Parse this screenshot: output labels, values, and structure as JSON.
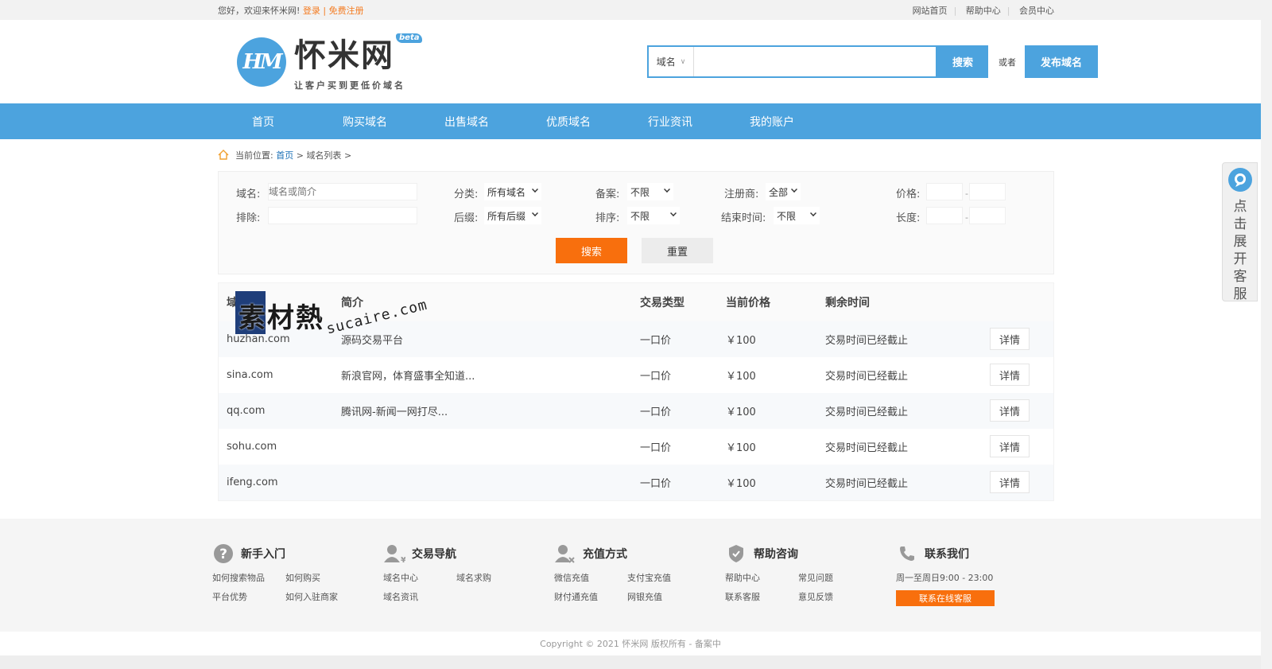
{
  "topbar": {
    "greeting": "您好，欢迎来怀米网!",
    "login": "登录",
    "divider": "|",
    "register": "免费注册",
    "links": [
      "网站首页",
      "帮助中心",
      "会员中心"
    ]
  },
  "logo": {
    "mark": "HM",
    "name": "怀米网",
    "badge": "beta",
    "slogan": "让客户买到更低价域名"
  },
  "search": {
    "type": "域名",
    "value": "",
    "button": "搜索",
    "or": "或者",
    "publish": "发布域名"
  },
  "nav": [
    "首页",
    "购买域名",
    "出售域名",
    "优质域名",
    "行业资讯",
    "我的账户"
  ],
  "breadcrumb": {
    "prefix": "当前位置:",
    "home": "首页",
    "sep1": ">",
    "current": "域名列表",
    "sep2": ">"
  },
  "filter": {
    "domain_label": "域名:",
    "domain_placeholder": "域名或简介",
    "category_label": "分类:",
    "category_value": "所有域名",
    "record_label": "备案:",
    "record_value": "不限",
    "registrar_label": "注册商:",
    "registrar_value": "全部",
    "price_label": "价格:",
    "exclude_label": "排除:",
    "suffix_label": "后缀:",
    "suffix_value": "所有后缀",
    "sort_label": "排序:",
    "sort_value": "不限",
    "endtime_label": "结束时间:",
    "endtime_value": "不限",
    "length_label": "长度:",
    "dash": "-",
    "search_button": "搜索",
    "reset_button": "重置"
  },
  "table": {
    "headers": [
      "域名",
      "简介",
      "交易类型",
      "当前价格",
      "剩余时间"
    ],
    "detail_label": "详情",
    "rows": [
      {
        "domain": "huzhan.com",
        "desc": "源码交易平台",
        "type": "一口价",
        "price": "￥100",
        "time": "交易时间已经截止"
      },
      {
        "domain": "sina.com",
        "desc": "新浪官网，体育盛事全知道...",
        "type": "一口价",
        "price": "￥100",
        "time": "交易时间已经截止"
      },
      {
        "domain": "qq.com",
        "desc": "腾讯网-新闻一网打尽...",
        "type": "一口价",
        "price": "￥100",
        "time": "交易时间已经截止"
      },
      {
        "domain": "sohu.com",
        "desc": "",
        "type": "一口价",
        "price": "￥100",
        "time": "交易时间已经截止"
      },
      {
        "domain": "ifeng.com",
        "desc": "",
        "type": "一口价",
        "price": "￥100",
        "time": "交易时间已经截止"
      }
    ]
  },
  "footer": {
    "cols": [
      {
        "title": "新手入门",
        "icon": "question-icon",
        "links": [
          "如何搜索物品",
          "如何购买",
          "平台优势",
          "如何入驻商家"
        ]
      },
      {
        "title": "交易导航",
        "icon": "user-yen-icon",
        "links": [
          "域名中心",
          "域名求购",
          "域名资讯"
        ]
      },
      {
        "title": "充值方式",
        "icon": "user-pay-icon",
        "links": [
          "微信充值",
          "支付宝充值",
          "财付通充值",
          "网银充值"
        ]
      },
      {
        "title": "帮助咨询",
        "icon": "shield-icon",
        "links": [
          "帮助中心",
          "常见问题",
          "联系客服",
          "意见反馈"
        ]
      }
    ],
    "contact": {
      "title": "联系我们",
      "icon": "phone-icon",
      "hours": "周一至周日9:00 - 23:00",
      "button": "联系在线客服"
    },
    "copyright": "Copyright © 2021 怀米网 版权所有 - 备案中"
  },
  "side_service": {
    "label": "点击展开客服",
    "icon": "customer-service-icon"
  },
  "watermark": {
    "text": "素材熱",
    "url": "sucaire.com"
  },
  "colors": {
    "primary": "#4ca3de",
    "accent": "#f86f0d",
    "link": "#1a6fb5"
  }
}
